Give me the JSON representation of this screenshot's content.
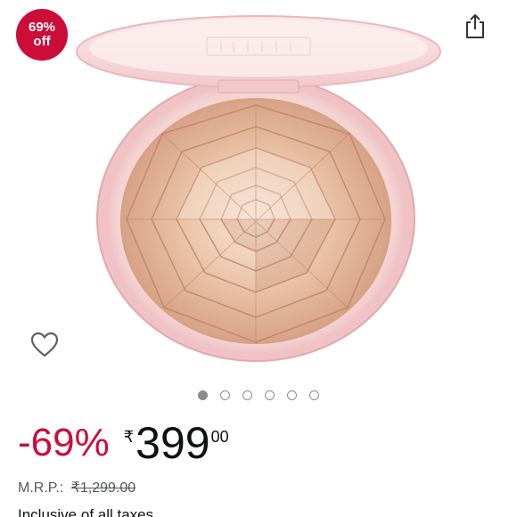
{
  "badge": {
    "percent": "69%",
    "off": "off",
    "color": "#cc0c39"
  },
  "icons": {
    "share": "share-icon",
    "wishlist": "heart-outline-icon"
  },
  "carousel": {
    "total": 6,
    "active_index": 0
  },
  "price": {
    "discount": "-69%",
    "currency_symbol": "₹",
    "whole": "399",
    "fraction": "00",
    "discount_color": "#cc0c39"
  },
  "mrp": {
    "label": "M.R.P.:",
    "value": "₹1,299.00"
  },
  "inclusive": {
    "text": "Inclusive of all taxes"
  }
}
